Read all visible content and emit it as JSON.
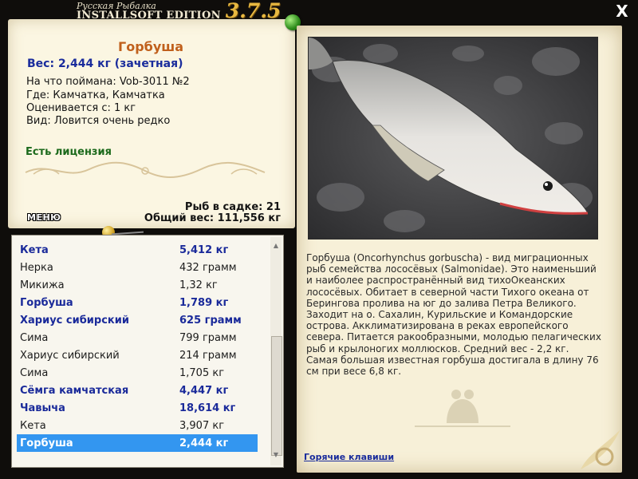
{
  "app": {
    "logo_line1": "Русская Рыбалка",
    "logo_line2": "INSTALLSOFT EDITION",
    "version": "3.7.5",
    "close_label": "X"
  },
  "fish": {
    "name": "Горбуша",
    "weight": "Вес: 2,444 кг (зачетная)",
    "bait": "На что поймана: Vob-3011 №2",
    "location": "Где: Камчатка, Камчатка",
    "rated_from": "Оценивается с: 1 кг",
    "rarity": "Вид: Ловится очень редко",
    "license": "Есть лицензия"
  },
  "keepnet": {
    "count": "Рыб в садке: 21",
    "total": "Общий вес: 111,556 кг"
  },
  "menu_label": "МЕНЮ",
  "catch_list": [
    {
      "name": "Кета",
      "weight": "5,412 кг",
      "rare": true,
      "selected": false
    },
    {
      "name": "Нерка",
      "weight": "432 грамм",
      "rare": false,
      "selected": false
    },
    {
      "name": "Микижа",
      "weight": "1,32 кг",
      "rare": false,
      "selected": false
    },
    {
      "name": "Горбуша",
      "weight": "1,789 кг",
      "rare": true,
      "selected": false
    },
    {
      "name": "Хариус сибирский",
      "weight": "625 грамм",
      "rare": true,
      "selected": false
    },
    {
      "name": "Сима",
      "weight": "799 грамм",
      "rare": false,
      "selected": false
    },
    {
      "name": "Хариус сибирский",
      "weight": "214 грамм",
      "rare": false,
      "selected": false
    },
    {
      "name": "Сима",
      "weight": "1,705 кг",
      "rare": false,
      "selected": false
    },
    {
      "name": "Сёмга камчатская",
      "weight": "4,447 кг",
      "rare": true,
      "selected": false
    },
    {
      "name": "Чавыча",
      "weight": "18,614 кг",
      "rare": true,
      "selected": false
    },
    {
      "name": "Кета",
      "weight": "3,907 кг",
      "rare": false,
      "selected": false
    },
    {
      "name": "Горбуша",
      "weight": "2,444 кг",
      "rare": true,
      "selected": true
    }
  ],
  "description": "Горбуша (Oncorhynchus gorbuscha) - вид миграционных рыб семейства лососёвых (Salmonidae). Это наименьший и наиболее распространённый вид тихоОкеанских лососёвых. Обитает в северной части Тихого океана от Берингова пролива на юг до залива Петра Великого. Заходит на о. Сахалин, Курильские и Командорские острова. Акклиматизирована в реках европейского севера. Питается ракообразными, молодью пелагических рыб и крылоногих моллюсков. Средний вес - 2,2 кг. Самая большая известная горбуша достигала в длину 76 см при весе 6,8 кг.",
  "hotkeys_label": "Горячие клавиши",
  "colors": {
    "rare_text": "#1a2a9a",
    "selected_bg": "#3396f0",
    "fish_name": "#c0601c",
    "license": "#1c6a1c"
  }
}
